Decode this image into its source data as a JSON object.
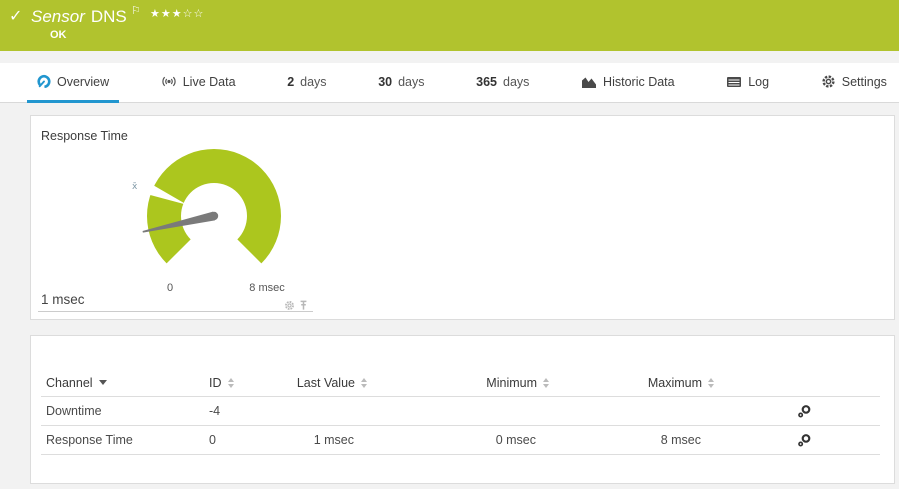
{
  "colors": {
    "green_header": "#b1c32e",
    "green_gauge": "#acc61e",
    "blue_accent": "#2196cf",
    "page_bg": "#f2f2f2"
  },
  "header": {
    "check": "✓",
    "title_italic": "Sensor",
    "title_rest": "DNS",
    "flag": "⚐",
    "stars": "★★★☆☆",
    "stars_filled": 3,
    "stars_total": 5,
    "status": "OK"
  },
  "tabs": [
    {
      "label": "Overview",
      "icon": "gauge-icon",
      "active": true
    },
    {
      "label": "Live Data",
      "icon": "broadcast-icon"
    },
    {
      "num": "2",
      "label": "days"
    },
    {
      "num": "30",
      "label": "days"
    },
    {
      "num": "365",
      "label": "days"
    },
    {
      "label": "Historic Data",
      "icon": "area-chart-icon"
    },
    {
      "label": "Log",
      "icon": "log-icon"
    },
    {
      "label": "Settings",
      "icon": "gear-icon"
    }
  ],
  "gauge_panel": {
    "title": "Response Time",
    "value": 1,
    "unit": "msec",
    "value_label": "1 msec",
    "scale_min": 0,
    "scale_max": 8,
    "scale_min_label": "0",
    "scale_max_label": "8 msec",
    "average_marker_value": 2,
    "average_symbol": "x̄"
  },
  "table": {
    "columns": [
      {
        "label": "Channel",
        "sorted": "desc"
      },
      {
        "label": "ID"
      },
      {
        "label": "Last Value"
      },
      {
        "label": "Minimum"
      },
      {
        "label": "Maximum"
      }
    ],
    "rows": [
      {
        "channel": "Downtime",
        "id": "-4",
        "last_value": "",
        "minimum": "",
        "maximum": ""
      },
      {
        "channel": "Response Time",
        "id": "0",
        "last_value": "1 msec",
        "minimum": "0 msec",
        "maximum": "8 msec"
      }
    ]
  }
}
